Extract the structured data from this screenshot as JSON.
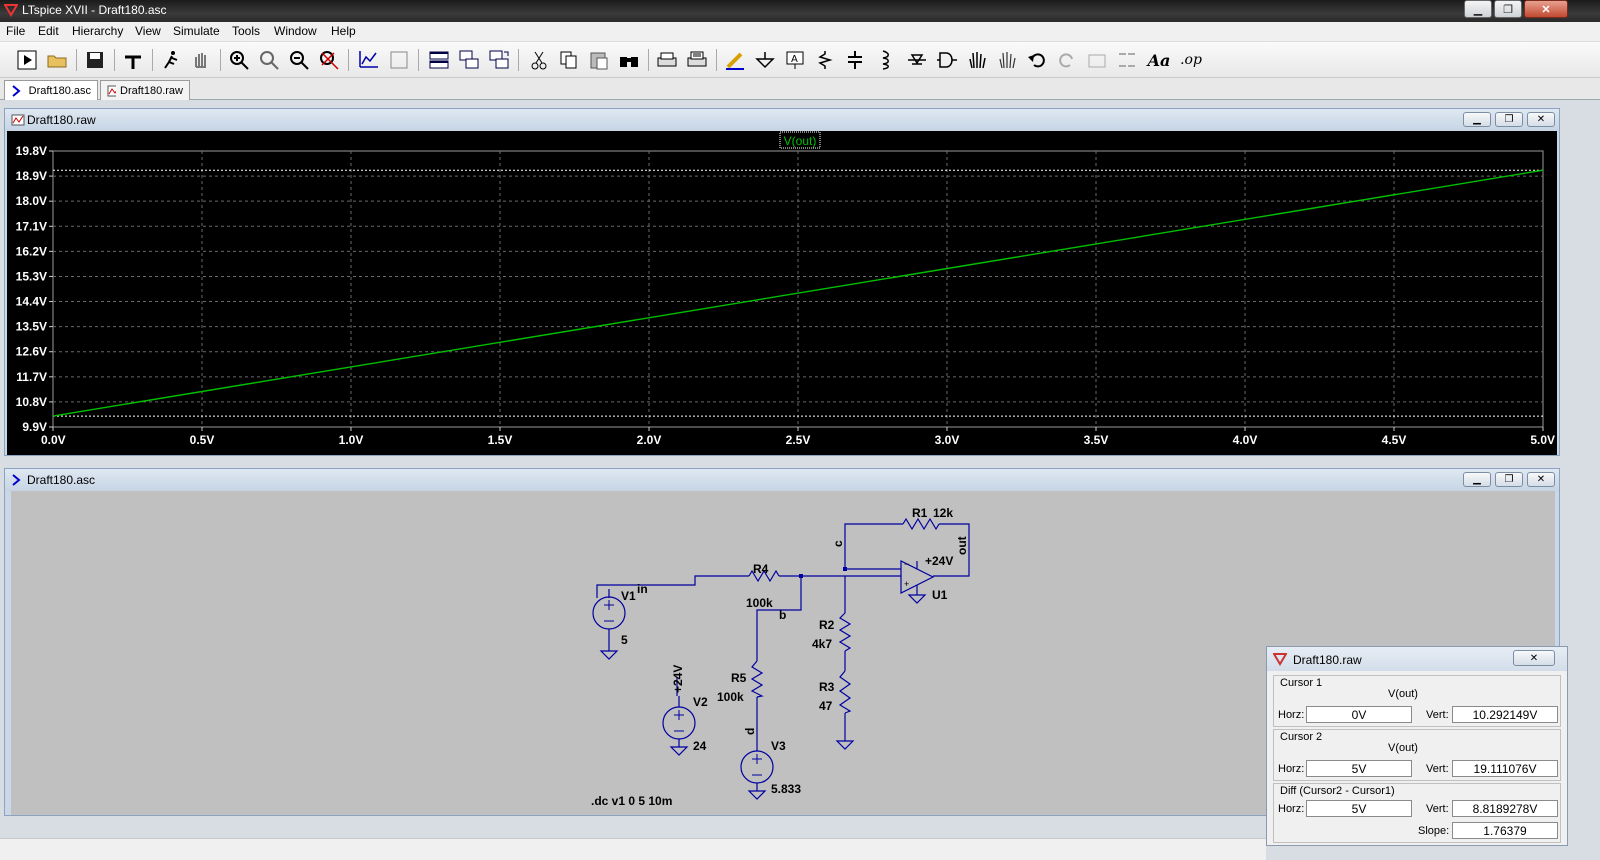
{
  "window": {
    "title": "LTspice XVII - Draft180.asc"
  },
  "menu": [
    "File",
    "Edit",
    "Hierarchy",
    "View",
    "Simulate",
    "Tools",
    "Window",
    "Help"
  ],
  "tabs": [
    {
      "label": "Draft180.asc",
      "icon": "schematic-icon",
      "active": true
    },
    {
      "label": "Draft180.raw",
      "icon": "waveform-icon",
      "active": false
    }
  ],
  "waveform_window": {
    "title": "Draft180.raw",
    "trace_label": "V(out)",
    "trace_color": "#00c000",
    "background": "#000000"
  },
  "chart_data": {
    "type": "line",
    "series": [
      {
        "name": "V(out)",
        "x": [
          0.0,
          5.0
        ],
        "y": [
          10.292149,
          19.111076
        ]
      }
    ],
    "xlabel": "",
    "ylabel": "",
    "xlim": [
      0.0,
      5.0
    ],
    "ylim": [
      9.9,
      19.8
    ],
    "x_ticks": [
      "0.0V",
      "0.5V",
      "1.0V",
      "1.5V",
      "2.0V",
      "2.5V",
      "3.0V",
      "3.5V",
      "4.0V",
      "4.5V",
      "5.0V"
    ],
    "y_ticks": [
      "19.8V",
      "18.9V",
      "18.0V",
      "17.1V",
      "16.2V",
      "15.3V",
      "14.4V",
      "13.5V",
      "12.6V",
      "11.7V",
      "10.8V",
      "9.9V"
    ],
    "cursor_levels": [
      10.292149,
      19.111076
    ],
    "grid": true
  },
  "schematic_window": {
    "title": "Draft180.asc",
    "labels": {
      "r1_name": "R1",
      "r1_value": "12k",
      "r4_name": "R4",
      "r4_value": "100k",
      "r2_name": "R2",
      "r2_value": "4k7",
      "r3_name": "R3",
      "r3_value": "47",
      "r5_name": "R5",
      "r5_value": "100k",
      "v1_name": "V1",
      "v1_value": "5",
      "v2_name": "V2",
      "v2_value": "24",
      "v3_name": "V3",
      "v3_value": "5.833",
      "u1_name": "U1",
      "u1_supply": "+24V",
      "v2_net": "+24V",
      "net_in": "in",
      "net_b": "b",
      "net_c": "c",
      "net_d": "d",
      "net_out": "out",
      "directive": ".dc v1 0 5 10m"
    }
  },
  "cursor_window": {
    "title": "Draft180.raw",
    "cursor1": {
      "group": "Cursor 1",
      "trace": "V(out)",
      "horz_label": "Horz:",
      "horz": "0V",
      "vert_label": "Vert:",
      "vert": "10.292149V"
    },
    "cursor2": {
      "group": "Cursor 2",
      "trace": "V(out)",
      "horz_label": "Horz:",
      "horz": "5V",
      "vert_label": "Vert:",
      "vert": "19.111076V"
    },
    "diff": {
      "group": "Diff (Cursor2 - Cursor1)",
      "horz_label": "Horz:",
      "horz": "5V",
      "vert_label": "Vert:",
      "vert": "8.8189278V",
      "slope_label": "Slope:",
      "slope": "1.76379"
    }
  }
}
